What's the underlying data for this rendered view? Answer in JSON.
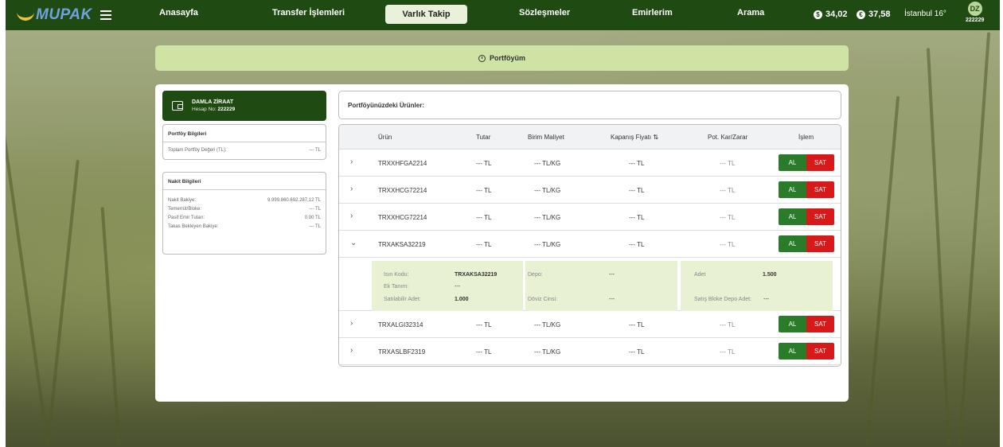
{
  "topbar": {
    "logo_text": "MUPAK",
    "nav": [
      "Anasayfa",
      "Transfer İşlemleri",
      "Varlık Takip",
      "Sözleşmeler",
      "Emirlerim",
      "Arama"
    ],
    "active_nav": "Varlık Takip",
    "usd_symbol": "$",
    "usd_rate": "34,02",
    "eur_symbol": "€",
    "eur_rate": "37,58",
    "weather": "İstanbul 16°",
    "avatar_initials": "DZ",
    "avatar_id": "222229"
  },
  "page_title": "Portföyüm",
  "account": {
    "name": "DAMLA ZİRAAT",
    "number_label": "Hesap No:",
    "number": "222229"
  },
  "portfolio_info": {
    "title": "Portföy Bilgileri",
    "total_label": "Toplam Portföy Değeri (TL):",
    "total_value": "--- TL"
  },
  "cash_info": {
    "title": "Nakit Bilgileri",
    "rows": [
      {
        "label": "Nakit Bakiye:",
        "value": "9.999.860.692.287,12 TL"
      },
      {
        "label": "Temerrüt/Bloke:",
        "value": "--- TL"
      },
      {
        "label": "Pasif Emir Tutarı:",
        "value": "0,00 TL"
      },
      {
        "label": "Takas Bekleyen Bakiye:",
        "value": "--- TL"
      }
    ]
  },
  "products_header": "Portföyünüzdeki Ürünler:",
  "table": {
    "headers": {
      "product": "Ürün",
      "amount": "Tutar",
      "unit_cost": "Birim Maliyet",
      "close_price": "Kapanış Fiyatı",
      "sort_icon": "⇅",
      "pnl": "Pot. Kar/Zarar",
      "action": "İşlem"
    },
    "buy_label": "AL",
    "sell_label": "SAT",
    "rows": [
      {
        "product": "TRXXHFGA2214",
        "amount": "--- TL",
        "unit_cost": "--- TL/KG",
        "close_price": "--- TL",
        "pnl": "--- TL",
        "expanded": false
      },
      {
        "product": "TRXXHCG72214",
        "amount": "--- TL",
        "unit_cost": "--- TL/KG",
        "close_price": "--- TL",
        "pnl": "--- TL",
        "expanded": false
      },
      {
        "product": "TRXXHCG72214",
        "amount": "--- TL",
        "unit_cost": "--- TL/KG",
        "close_price": "--- TL",
        "pnl": "--- TL",
        "expanded": false
      },
      {
        "product": "TRXAKSA32219",
        "amount": "--- TL",
        "unit_cost": "--- TL/KG",
        "close_price": "--- TL",
        "pnl": "--- TL",
        "expanded": true
      },
      {
        "product": "TRXALGI32314",
        "amount": "--- TL",
        "unit_cost": "--- TL/KG",
        "close_price": "--- TL",
        "pnl": "--- TL",
        "expanded": false
      },
      {
        "product": "TRXASLBF2319",
        "amount": "--- TL",
        "unit_cost": "--- TL/KG",
        "close_price": "--- TL",
        "pnl": "--- TL",
        "expanded": false
      }
    ],
    "detail": {
      "isin_label": "Isın Kodu:",
      "isin_value": "TRXAKSA32219",
      "ek_label": "Ek Tanım:",
      "ek_value": "---",
      "sellable_label": "Satılabilir Adet:",
      "sellable_value": "1.000",
      "depo_label": "Depo:",
      "depo_value": "---",
      "currency_label": "Döviz Cinsi:",
      "currency_value": "---",
      "adet_label": "Adet",
      "adet_value": "1.500",
      "block_label": "Satış Bloke Depo Adet:",
      "block_value": "---"
    }
  }
}
